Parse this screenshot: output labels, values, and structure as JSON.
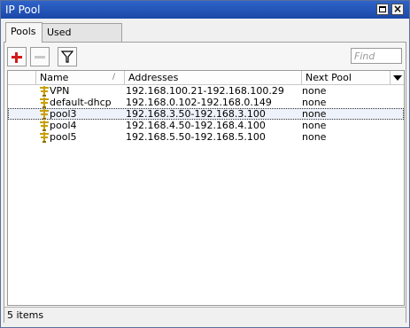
{
  "window": {
    "title": "IP Pool"
  },
  "tabs": [
    {
      "label": "Pools",
      "active": true
    },
    {
      "label": "Used Addresses",
      "active": false
    }
  ],
  "toolbar": {
    "add_icon": "plus-icon",
    "remove_icon": "minus-icon",
    "filter_icon": "filter-icon",
    "find_placeholder": "Find"
  },
  "table": {
    "columns": [
      "Name",
      "Addresses",
      "Next Pool"
    ],
    "sort_indicator": "/",
    "rows": [
      {
        "name": "VPN",
        "addresses": "192.168.100.21-192.168.100.29",
        "next_pool": "none"
      },
      {
        "name": "default-dhcp",
        "addresses": "192.168.0.102-192.168.0.149",
        "next_pool": "none"
      },
      {
        "name": "pool3",
        "addresses": "192.168.3.50-192.168.3.100",
        "next_pool": "none"
      },
      {
        "name": "pool4",
        "addresses": "192.168.4.50-192.168.4.100",
        "next_pool": "none"
      },
      {
        "name": "pool5",
        "addresses": "192.168.5.50-192.168.5.100",
        "next_pool": "none"
      }
    ]
  },
  "status": {
    "text": "5 items"
  },
  "colors": {
    "titlebar": "#1b48a8",
    "add_icon": "#d11a1a",
    "pool_icon": "#c8a000"
  }
}
